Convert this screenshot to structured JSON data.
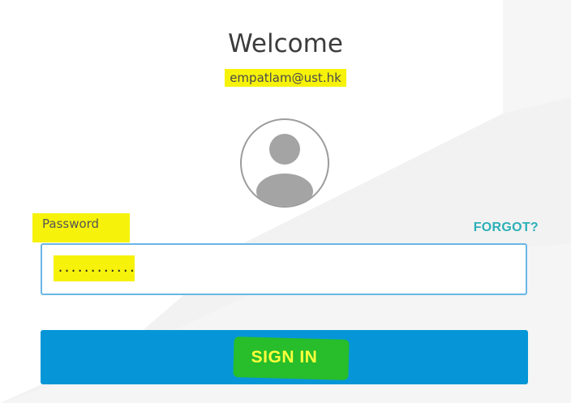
{
  "header": {
    "title": "Welcome",
    "email": "empatlam@ust.hk"
  },
  "avatar": {
    "icon": "user-avatar-icon"
  },
  "password": {
    "label": "Password",
    "forgot_label": "FORGOT?",
    "value": "............"
  },
  "actions": {
    "signin_label": "SIGN IN"
  },
  "colors": {
    "accent_button": "#0696d7",
    "link": "#2bb0b8",
    "highlight": "#f6f20a",
    "input_border": "#69b6e6"
  }
}
